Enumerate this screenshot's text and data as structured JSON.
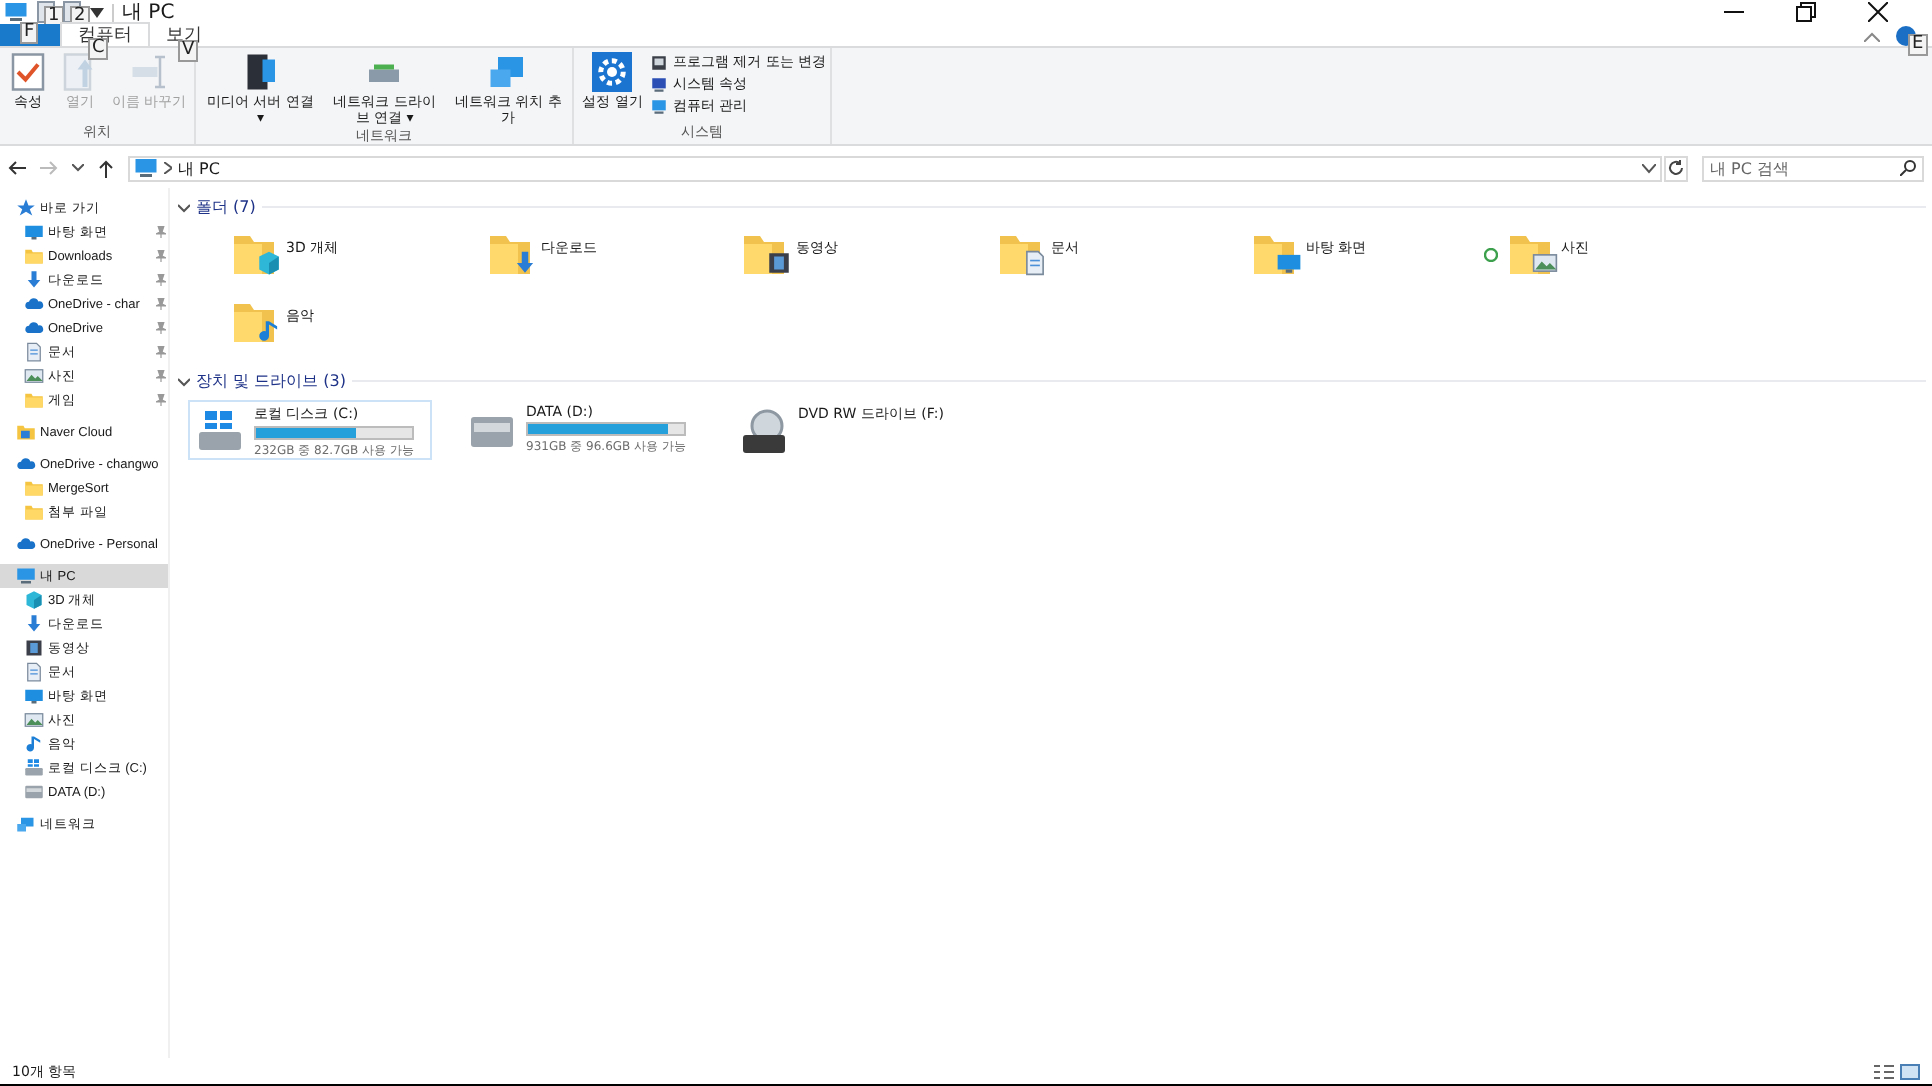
{
  "window": {
    "title": "내 PC",
    "keytips_quick": [
      "1",
      "2"
    ],
    "help_keytip": "E"
  },
  "tabs": [
    {
      "kind": "file",
      "keytip": "F",
      "selected": false
    },
    {
      "kind": "tab",
      "label": "컴퓨터",
      "keytip": "C",
      "selected": true
    },
    {
      "kind": "tab",
      "label": "보기",
      "keytip": "V",
      "selected": false
    }
  ],
  "ribbon": [
    {
      "group": "위치",
      "buttons": [
        {
          "kind": "check",
          "label": "속성",
          "disabled": false
        },
        {
          "kind": "open",
          "label": "열기",
          "disabled": true
        },
        {
          "kind": "rename",
          "label": "이름 바꾸기",
          "disabled": true
        }
      ]
    },
    {
      "group": "네트워크",
      "buttons": [
        {
          "kind": "media",
          "label": "미디어 서버 연결 ▾",
          "disabled": false
        },
        {
          "kind": "netdrive",
          "label": "네트워크 드라이브 연결 ▾",
          "disabled": false
        },
        {
          "kind": "netloc",
          "label": "네트워크 위치 추가",
          "disabled": false
        }
      ]
    },
    {
      "group": "시스템",
      "buttons": [
        {
          "kind": "settings",
          "label": "설정 열기",
          "disabled": false
        }
      ],
      "small": [
        {
          "kind": "uninstall",
          "label": "프로그램 제거 또는 변경"
        },
        {
          "kind": "sysprop",
          "label": "시스템 속성"
        },
        {
          "kind": "manage",
          "label": "컴퓨터 관리"
        }
      ]
    }
  ],
  "address": {
    "path": "내 PC",
    "search_placeholder": "내 PC 검색"
  },
  "sidebar": [
    {
      "label": "바로 가기",
      "kind": "quick",
      "selected": false,
      "children": [
        {
          "label": "바탕 화면",
          "kind": "desktop",
          "pinned": true,
          "selected": false
        },
        {
          "label": "Downloads",
          "kind": "folder",
          "pinned": true,
          "selected": false
        },
        {
          "label": "다운로드",
          "kind": "download",
          "pinned": true,
          "selected": false
        },
        {
          "label": "OneDrive - char",
          "kind": "cloud",
          "pinned": true,
          "selected": false
        },
        {
          "label": "OneDrive",
          "kind": "cloud",
          "pinned": true,
          "selected": false
        },
        {
          "label": "문서",
          "kind": "document",
          "pinned": true,
          "selected": false
        },
        {
          "label": "사진",
          "kind": "picture",
          "pinned": true,
          "selected": false
        },
        {
          "label": "게임",
          "kind": "folder",
          "pinned": true,
          "selected": false
        }
      ]
    },
    {
      "label": "Naver Cloud",
      "kind": "naver",
      "selected": false
    },
    {
      "label": "OneDrive - changwo",
      "kind": "cloud",
      "selected": false,
      "children": [
        {
          "label": "MergeSort",
          "kind": "folder",
          "pinned": false,
          "selected": false
        },
        {
          "label": "첨부 파일",
          "kind": "folder",
          "pinned": false,
          "selected": false
        }
      ]
    },
    {
      "label": "OneDrive - Personal",
      "kind": "cloud",
      "selected": false
    },
    {
      "label": "내 PC",
      "kind": "pc",
      "selected": true,
      "children": [
        {
          "label": "3D 개체",
          "kind": "cube",
          "pinned": false,
          "selected": false
        },
        {
          "label": "다운로드",
          "kind": "download",
          "pinned": false,
          "selected": false
        },
        {
          "label": "동영상",
          "kind": "video",
          "pinned": false,
          "selected": false
        },
        {
          "label": "문서",
          "kind": "document",
          "pinned": false,
          "selected": false
        },
        {
          "label": "바탕 화면",
          "kind": "desktop",
          "pinned": false,
          "selected": false
        },
        {
          "label": "사진",
          "kind": "picture",
          "pinned": false,
          "selected": false
        },
        {
          "label": "음악",
          "kind": "music",
          "pinned": false,
          "selected": false
        },
        {
          "label": "로컬 디스크 (C:)",
          "kind": "windrive",
          "pinned": false,
          "selected": false
        },
        {
          "label": "DATA (D:)",
          "kind": "drive",
          "pinned": false,
          "selected": false
        }
      ]
    },
    {
      "label": "네트워크",
      "kind": "network",
      "selected": false
    }
  ],
  "folders": {
    "heading": "폴더 (7)",
    "expanded": true,
    "items": [
      {
        "label": "3D 개체",
        "kind": "cube",
        "synced": false
      },
      {
        "label": "다운로드",
        "kind": "download",
        "synced": false
      },
      {
        "label": "동영상",
        "kind": "video",
        "synced": false
      },
      {
        "label": "문서",
        "kind": "document",
        "synced": false
      },
      {
        "label": "바탕 화면",
        "kind": "desktop",
        "synced": false
      },
      {
        "label": "사진",
        "kind": "picture",
        "synced": true
      },
      {
        "label": "음악",
        "kind": "music",
        "synced": false
      }
    ]
  },
  "drives": {
    "heading": "장치 및 드라이브 (3)",
    "expanded": true,
    "items": [
      {
        "label": "로컬 디스크 (C:)",
        "kind": "windrive",
        "level": 0.64,
        "space": "232GB 중 82.7GB 사용 가능",
        "selected": true
      },
      {
        "label": "DATA (D:)",
        "kind": "drive",
        "level": 0.9,
        "space": "931GB 중 96.6GB 사용 가능",
        "selected": false
      },
      {
        "label": "DVD RW 드라이브 (F:)",
        "kind": "dvd",
        "selected": false
      }
    ]
  },
  "status_bar": {
    "count": "10개 항목"
  }
}
